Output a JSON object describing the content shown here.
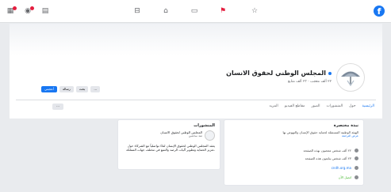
{
  "topbar": {
    "brand_letter": "f",
    "nav_icons": [
      "home-icon",
      "flag-icon",
      "watch-icon",
      "marketplace-icon",
      "groups-icon"
    ],
    "right_icons": [
      "menu-grid-icon",
      "messenger-icon",
      "notifications-icon"
    ]
  },
  "page": {
    "name": "المجلس الوطني لحقوق الانسان",
    "meta": "٢٢ ألف معجب · ٢٣ ألف متابع",
    "buttons": [
      "أعجبني",
      "رسالة",
      "بحث",
      "..."
    ]
  },
  "tabs": [
    "الرئيسية",
    "حول",
    "المنشورات",
    "الصور",
    "مقاطع الفيديو",
    "المزيد"
  ],
  "about": {
    "title": "نبذة مختصرة",
    "intro": "الهيئة الوطنية المستقلة لحماية حقوق الإنسان والنهوض بها",
    "intro_link": "عرض الترجمة",
    "rows": [
      {
        "icon": "likes-icon",
        "text": "٢٢ ألف شخص معجبون بهذه الصفحة"
      },
      {
        "icon": "followers-icon",
        "text": "٢٣ ألف شخص يتابعون هذه الصفحة"
      },
      {
        "icon": "link-icon",
        "text": "cndh.org.ma"
      },
      {
        "icon": "phone-icon",
        "text": "اتصل الآن"
      }
    ]
  },
  "post": {
    "title": "المنشورات",
    "author": "المجلس الوطني لحقوق الانسان",
    "time": "منذ ساعتين",
    "text": "يعقد المجلس الوطني لحقوق الإنسان لقاءً تواصلياً مع الشركاء حول تعزيز الحماية وتطوير آليات الرصد والتتبع في مختلف جهات المملكة."
  }
}
